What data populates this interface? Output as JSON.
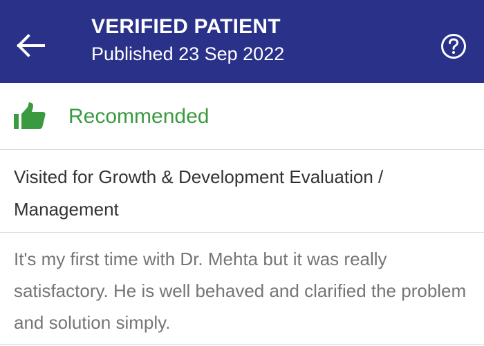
{
  "header": {
    "title": "VERIFIED PATIENT",
    "subtitle": "Published 23 Sep 2022",
    "back_icon": "arrow-left-icon",
    "help_icon": "help-circle-icon",
    "background_color": "#2a3189"
  },
  "recommendation": {
    "icon": "thumbs-up-icon",
    "label": "Recommended",
    "color": "#3b9a3f"
  },
  "visit": {
    "text": "Visited for Growth & Development Evaluation / Management"
  },
  "review": {
    "text": "It's my first time with Dr. Mehta but it was really satisfactory. He is well behaved and clarified the problem and solution simply."
  }
}
